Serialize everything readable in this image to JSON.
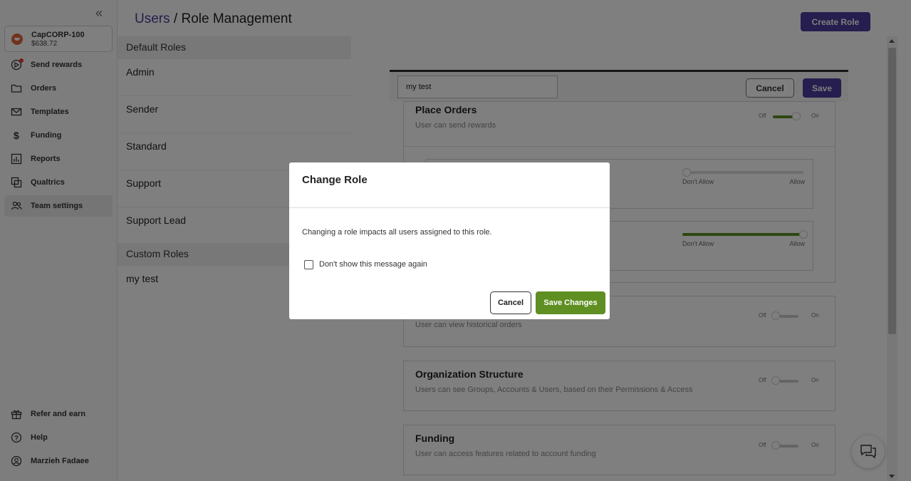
{
  "sidebar": {
    "account": {
      "name": "CapCORP-100",
      "balance": "$638.72"
    },
    "items": [
      {
        "label": "Send rewards",
        "icon": "send-icon"
      },
      {
        "label": "Orders",
        "icon": "folder-icon"
      },
      {
        "label": "Templates",
        "icon": "mail-icon"
      },
      {
        "label": "Funding",
        "icon": "dollar-icon"
      },
      {
        "label": "Reports",
        "icon": "chart-icon"
      },
      {
        "label": "Qualtrics",
        "icon": "qualtrics-icon"
      },
      {
        "label": "Team settings",
        "icon": "team-icon"
      }
    ],
    "footer": [
      {
        "label": "Refer and earn",
        "icon": "gift-icon"
      },
      {
        "label": "Help",
        "icon": "help-icon"
      },
      {
        "label": "Marzieh Fadaee",
        "icon": "user-icon"
      }
    ]
  },
  "header": {
    "breadcrumb_link": "Users",
    "breadcrumb_sep": "/",
    "title": "Role Management",
    "create_role": "Create Role"
  },
  "roles": {
    "default_header": "Default Roles",
    "default": [
      "Admin",
      "Sender",
      "Standard",
      "Support",
      "Support Lead"
    ],
    "custom_header": "Custom Roles",
    "custom": [
      "my test"
    ]
  },
  "editor": {
    "role_name": "my test",
    "cancel": "Cancel",
    "save": "Save"
  },
  "toggle_labels": {
    "off": "Off",
    "on": "On"
  },
  "slider_labels": {
    "deny": "Don't Allow",
    "allow": "Allow"
  },
  "permissions": [
    {
      "title": "Place Orders",
      "desc": "User can send rewards",
      "state": "on"
    },
    {
      "title": "",
      "desc": "User can view historical orders",
      "state": "off"
    },
    {
      "title": "Organization Structure",
      "desc": "Users can see Groups, Accounts & Users, based on their Permissions & Access",
      "state": "off"
    },
    {
      "title": "Funding",
      "desc": "User can access features related to account funding",
      "state": "off"
    }
  ],
  "sub_permissions": [
    {
      "value": "Don't Allow",
      "level": 0
    },
    {
      "value": "Allow",
      "level": 1
    }
  ],
  "modal": {
    "title": "Change Role",
    "message": "Changing a role impacts all users assigned to this role.",
    "checkbox_label": "Don't show this message again",
    "checkbox_checked": false,
    "cancel": "Cancel",
    "save": "Save Changes"
  },
  "colors": {
    "brand": "#4a3d9c",
    "success": "#5f8f22",
    "logo": "#e2673a",
    "notification": "#e43a3a"
  }
}
